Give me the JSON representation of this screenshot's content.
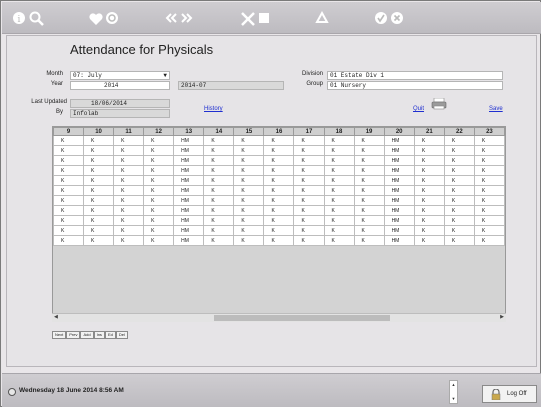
{
  "toolbar": {
    "icons": [
      "info-icon",
      "search-icon",
      "heart-icon",
      "refresh-icon",
      "previous-icon",
      "next-icon",
      "tools-icon",
      "new-page-icon",
      "recycle-icon",
      "confirm-icon",
      "cancel-icon"
    ]
  },
  "page": {
    "title": "Attendance for Physicals"
  },
  "form": {
    "month_label": "Month",
    "month_value": "07: July",
    "year_label": "Year",
    "year_value": "2014",
    "period_value": "2014-07",
    "division_label": "Division",
    "division_value": "01 Estate Div 1",
    "group_label": "Group",
    "group_value": "01 Nursery",
    "last_updated_label": "Last Updated",
    "last_updated_value": "18/06/2014",
    "by_label": "By",
    "by_value": "Infolab",
    "history_link": "History",
    "quit_link": "Quit",
    "save_link": "Save"
  },
  "grid": {
    "columns": [
      "9",
      "10",
      "11",
      "12",
      "13",
      "14",
      "15",
      "16",
      "17",
      "18",
      "19",
      "20",
      "21",
      "22",
      "23"
    ],
    "rows": [
      [
        "K",
        "K",
        "K",
        "K",
        "HM",
        "K",
        "K",
        "K",
        "K",
        "K",
        "K",
        "HM",
        "K",
        "K",
        "K"
      ],
      [
        "K",
        "K",
        "K",
        "K",
        "HM",
        "K",
        "K",
        "K",
        "K",
        "K",
        "K",
        "HM",
        "K",
        "K",
        "K"
      ],
      [
        "K",
        "K",
        "K",
        "K",
        "HM",
        "K",
        "K",
        "K",
        "K",
        "K",
        "K",
        "HM",
        "K",
        "K",
        "K"
      ],
      [
        "K",
        "K",
        "K",
        "K",
        "HM",
        "K",
        "K",
        "K",
        "K",
        "K",
        "K",
        "HM",
        "K",
        "K",
        "K"
      ],
      [
        "K",
        "K",
        "K",
        "K",
        "HM",
        "K",
        "K",
        "K",
        "K",
        "K",
        "K",
        "HM",
        "K",
        "K",
        "K"
      ],
      [
        "K",
        "K",
        "K",
        "K",
        "HM",
        "K",
        "K",
        "K",
        "K",
        "K",
        "K",
        "HM",
        "K",
        "K",
        "K"
      ],
      [
        "K",
        "K",
        "K",
        "K",
        "HM",
        "K",
        "K",
        "K",
        "K",
        "K",
        "K",
        "HM",
        "K",
        "K",
        "K"
      ],
      [
        "K",
        "K",
        "K",
        "K",
        "HM",
        "K",
        "K",
        "K",
        "K",
        "K",
        "K",
        "HM",
        "K",
        "K",
        "K"
      ],
      [
        "K",
        "K",
        "K",
        "K",
        "HM",
        "K",
        "K",
        "K",
        "K",
        "K",
        "K",
        "HM",
        "K",
        "K",
        "K"
      ],
      [
        "K",
        "K",
        "K",
        "K",
        "HM",
        "K",
        "K",
        "K",
        "K",
        "K",
        "K",
        "HM",
        "K",
        "K",
        "K"
      ],
      [
        "K",
        "K",
        "K",
        "K",
        "HM",
        "K",
        "K",
        "K",
        "K",
        "K",
        "K",
        "HM",
        "K",
        "K",
        "K"
      ]
    ],
    "buttons": [
      "Next",
      "Prev",
      "Add",
      "Ins",
      "Ed",
      "Del"
    ]
  },
  "statusbar": {
    "datetime": "Wednesday 18 June 2014 8:56 AM",
    "logoff_label": "Log Off"
  }
}
